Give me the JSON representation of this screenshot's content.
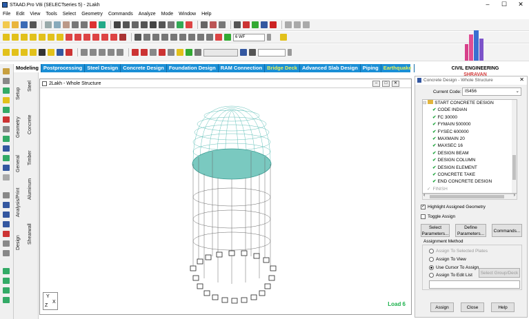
{
  "window": {
    "title": "STAAD.Pro V8i (SELECTseries 5) - 2Lakh",
    "minimize": "–",
    "maximize": "☐",
    "close": "✕"
  },
  "menu": [
    "File",
    "Edit",
    "View",
    "Tools",
    "Select",
    "Geometry",
    "Commands",
    "Analyze",
    "Mode",
    "Window",
    "Help"
  ],
  "toolbar": {
    "section_combo": "6 WF"
  },
  "tabs": [
    {
      "label": "Modeling",
      "state": "active"
    },
    {
      "label": "Postprocessing",
      "state": ""
    },
    {
      "label": "Steel Design",
      "state": ""
    },
    {
      "label": "Concrete Design",
      "state": ""
    },
    {
      "label": "Foundation Design",
      "state": ""
    },
    {
      "label": "RAM Connection",
      "state": ""
    },
    {
      "label": "Bridge Deck",
      "state": "highlight"
    },
    {
      "label": "Advanced Slab Design",
      "state": ""
    },
    {
      "label": "Piping",
      "state": ""
    },
    {
      "label": "Earthquake",
      "state": "highlight"
    }
  ],
  "side_tabs": {
    "setup": "Setup",
    "geometry": "Geometry",
    "general": "General",
    "analysis": "Analysis/Print",
    "design": "Design",
    "steel": "Steel",
    "concrete": "Concrete",
    "timber": "Timber",
    "aluminum": "Aluminum",
    "shearwall": "Shearwall"
  },
  "view": {
    "title": "2Lakh - Whole Structure",
    "load": "Load 6",
    "axis_y": "Y",
    "axis_x": "X",
    "axis_z": "Z"
  },
  "watermark": {
    "line1": "CIVIL ENGINEERING",
    "line2": "SHRAVAN"
  },
  "panel": {
    "title": "Concrete Design - Whole Structure",
    "current_code_label": "Current Code:",
    "current_code_value": "IS456",
    "tree_root": "START CONCRETE DESIGN",
    "tree_items": [
      "CODE INDIAN",
      "FC 30000",
      "FYMAIN 500000",
      "FYSEC 600000",
      "MAXMAIN 20",
      "MAXSEC 16",
      "DESIGN BEAM",
      "DESIGN COLUMN",
      "DESIGN ELEMENT",
      "CONCRETE TAKE",
      "END CONCRETE DESIGN"
    ],
    "tree_finish": "FINISH",
    "highlight_label": "Highlight Assigned Geometry",
    "toggle_label": "Toggle Assign",
    "select_params": "Select Parameters...",
    "define_params": "Define Parameters...",
    "commands": "Commands...",
    "assignment_method": "Assignment Method",
    "assign_options": [
      "Assign To Selected Plates",
      "Assign To View",
      "Use Cursor To Assign",
      "Assign To Edit List"
    ],
    "select_group": "Select Group/Deck",
    "assign": "Assign",
    "close": "Close",
    "help": "Help"
  }
}
